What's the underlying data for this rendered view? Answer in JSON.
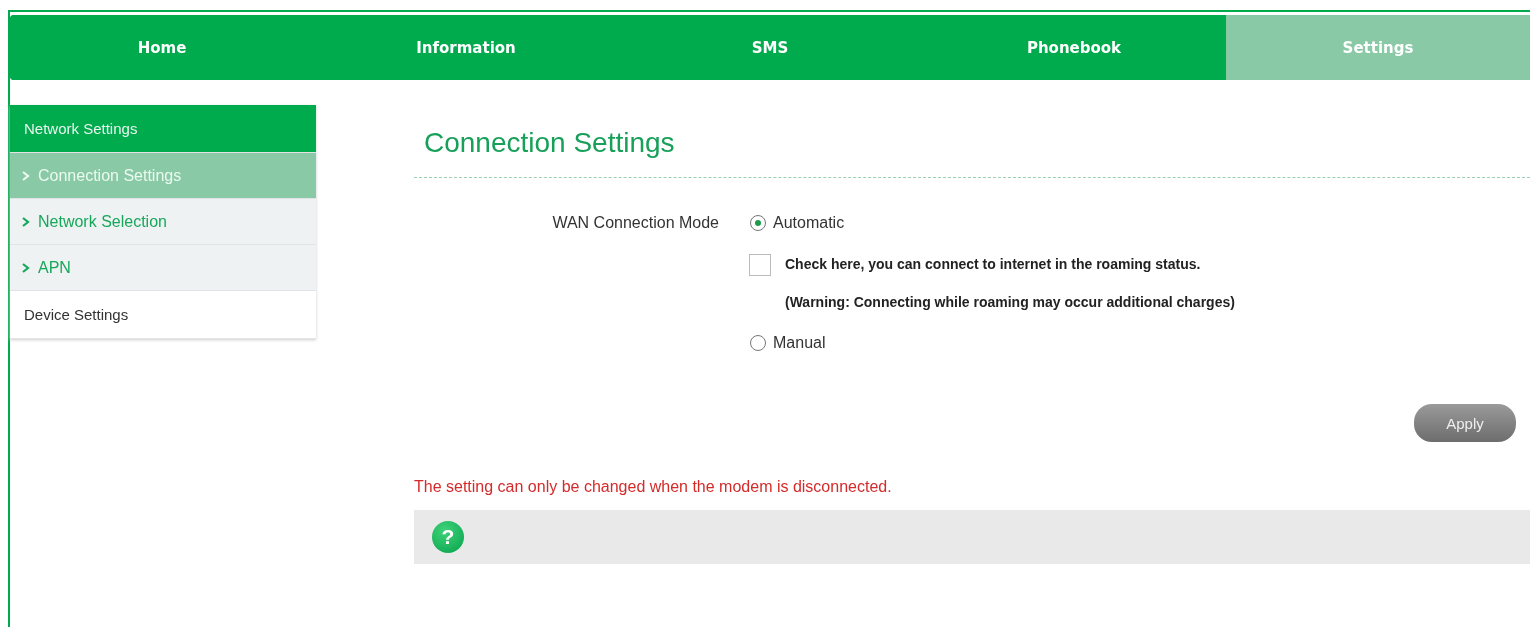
{
  "nav_tabs": [
    {
      "label": "Home",
      "selected": false
    },
    {
      "label": "Information",
      "selected": false
    },
    {
      "label": "SMS",
      "selected": false
    },
    {
      "label": "Phonebook",
      "selected": false
    },
    {
      "label": "Settings",
      "selected": true
    }
  ],
  "sidebar": {
    "items": [
      {
        "label": "Network Settings",
        "expanded": true,
        "children": [
          {
            "label": "Connection Settings",
            "selected": true
          },
          {
            "label": "Network Selection",
            "selected": false
          },
          {
            "label": "APN",
            "selected": false
          }
        ]
      },
      {
        "label": "Device Settings",
        "expanded": false
      }
    ]
  },
  "page_title": "Connection Settings",
  "form": {
    "label": "WAN Connection Mode",
    "options": [
      {
        "kind": "radio",
        "label": "Automatic",
        "selected": true
      },
      {
        "kind": "checkbox",
        "label": "Check here, you can connect to internet in the roaming status.",
        "checked": false,
        "note": "(Warning: Connecting while roaming may occur additional charges)"
      },
      {
        "kind": "radio",
        "label": "Manual",
        "selected": false
      }
    ]
  },
  "apply_button": "Apply",
  "warning": "The setting can only be changed when the modem is disconnected.",
  "help_icon": "?"
}
